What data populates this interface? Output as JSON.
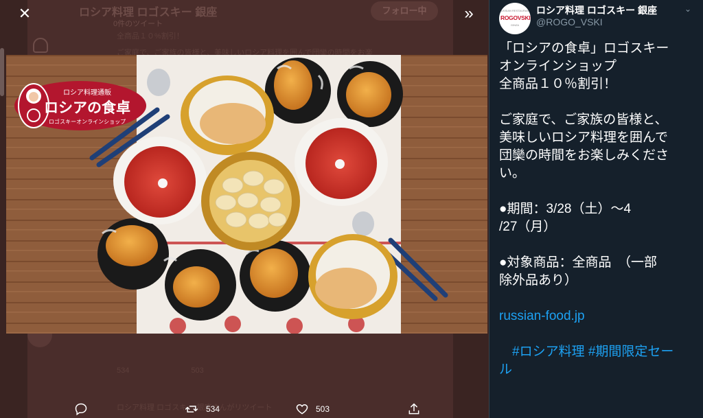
{
  "background": {
    "header_name": "ロシア料理 ロゴスキー 銀座",
    "header_sub": "0件のツイート",
    "follow_label": "フォロー中",
    "line1": "全商品１０%割引！",
    "line2": "ご家庭で、ご家族の皆様と、美味しいロシア料理を囲んで団欒の時間をお楽",
    "actions": [
      "534",
      "503"
    ],
    "retweet_note": "ロシア料理 ロゴスキー 銀座さんがリツイート"
  },
  "media": {
    "banner_top": "ロシア料理通販",
    "banner_main": "ロシアの食卓",
    "banner_sub": "ロゴスキーオンラインショップ"
  },
  "controls": {
    "close_icon": "close-icon",
    "collapse_icon": "double-chevron-right-icon"
  },
  "actions": {
    "reply_count": "",
    "retweet_count": "534",
    "like_count": "503"
  },
  "author": {
    "avatar_text": "ROGOVSKI",
    "avatar_small_top": "RUSSIAN RESTAURANT",
    "avatar_small_bottom": "GINZA",
    "name": "ロシア料理 ロゴスキー 銀座",
    "handle": "@ROGO_VSKI"
  },
  "tweet": {
    "line1": "「ロシアの食卓」ロゴスキー",
    "line2": "オンラインショップ",
    "line3": "全商品１０％割引！",
    "line4": "ご家庭で、ご家族の皆様と、",
    "line5": "美味しいロシア料理を囲んで",
    "line6": "団欒の時間をお楽しみくださ",
    "line7": "い。",
    "line8": "●期間：3/28（土）〜4",
    "line9": "/27（月）",
    "line10": "●対象商品：全商品　（一部",
    "line11": "除外品あり）",
    "link": "russian-food.jp",
    "hashtags1": "　#ロシア料理 #期間限定セー",
    "hashtags2": "ル"
  },
  "colors": {
    "panel_bg": "#15202b",
    "link": "#1da1f2",
    "brand_red": "#c8172f"
  }
}
